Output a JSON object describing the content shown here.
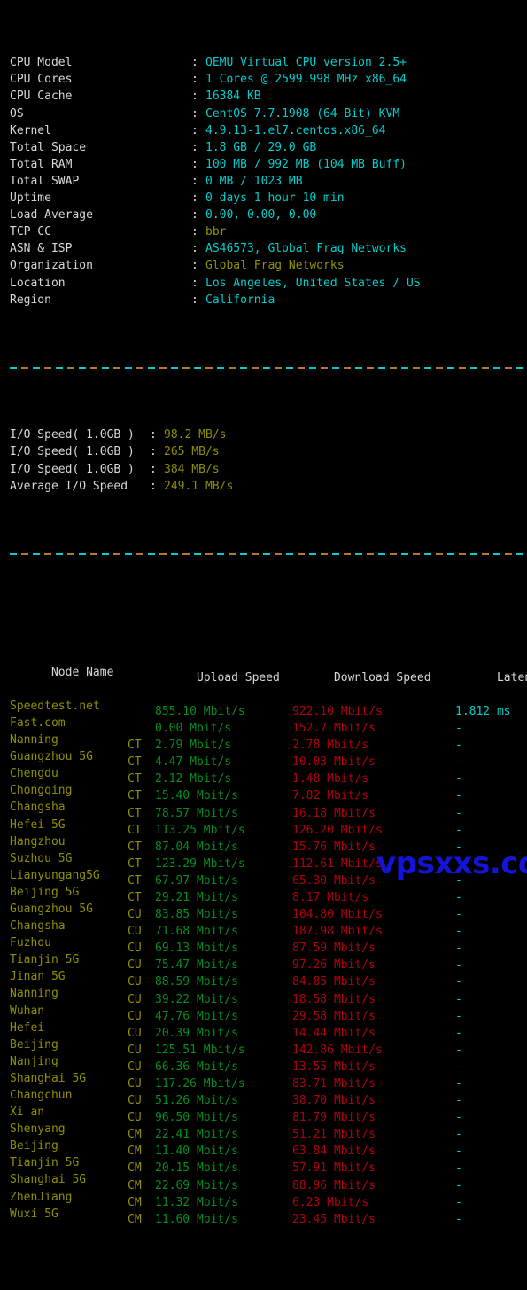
{
  "theme": {
    "background": "#000000",
    "label_color": "#d8d8d8",
    "cyan": "#00cdcd",
    "yellow": "#8f8f00",
    "green": "#008f1f",
    "red": "#b00010",
    "watermark_color": "#1414d8"
  },
  "sysinfo": {
    "colon": ":",
    "rows": [
      {
        "label": "CPU Model",
        "value": "QEMU Virtual CPU version 2.5+",
        "color": "c-cyan"
      },
      {
        "label": "CPU Cores",
        "value": "1 Cores @ 2599.998 MHz x86_64",
        "color": "c-cyan"
      },
      {
        "label": "CPU Cache",
        "value": "16384 KB",
        "color": "c-cyan"
      },
      {
        "label": "OS",
        "value": "CentOS 7.7.1908 (64 Bit) KVM",
        "color": "c-cyan"
      },
      {
        "label": "Kernel",
        "value": "4.9.13-1.el7.centos.x86_64",
        "color": "c-cyan"
      },
      {
        "label": "Total Space",
        "value": "1.8 GB / 29.0 GB",
        "color": "c-cyan"
      },
      {
        "label": "Total RAM",
        "value": "100 MB / 992 MB (104 MB Buff)",
        "color": "c-cyan"
      },
      {
        "label": "Total SWAP",
        "value": "0 MB / 1023 MB",
        "color": "c-cyan"
      },
      {
        "label": "Uptime",
        "value": "0 days 1 hour 10 min",
        "color": "c-cyan"
      },
      {
        "label": "Load Average",
        "value": "0.00, 0.00, 0.00",
        "color": "c-cyan"
      },
      {
        "label": "TCP CC",
        "value": "bbr",
        "color": "c-yellow"
      },
      {
        "label": "ASN & ISP",
        "value": "AS46573, Global Frag Networks",
        "color": "c-cyan"
      },
      {
        "label": "Organization",
        "value": "Global Frag Networks",
        "color": "c-yellow"
      },
      {
        "label": "Location",
        "value": "Los Angeles, United States / US",
        "color": "c-cyan"
      },
      {
        "label": "Region",
        "value": "California",
        "color": "c-cyan"
      }
    ]
  },
  "iotest": {
    "colon": ":",
    "rows": [
      {
        "label": "I/O Speed( 1.0GB )",
        "value": "98.2 MB/s"
      },
      {
        "label": "I/O Speed( 1.0GB )",
        "value": "265 MB/s"
      },
      {
        "label": "I/O Speed( 1.0GB )",
        "value": "384 MB/s"
      },
      {
        "label": "Average I/O Speed",
        "value": "249.1 MB/s"
      }
    ]
  },
  "speedtest": {
    "headers": {
      "node": "Node Name",
      "isp": "",
      "upload": "Upload Speed",
      "download": "Download Speed",
      "latency": "Latency"
    },
    "rows": [
      {
        "node": "Speedtest.net",
        "isp": "",
        "upload": "855.10 Mbit/s",
        "download": "922.10 Mbit/s",
        "latency": "1.812 ms"
      },
      {
        "node": "Fast.com",
        "isp": "",
        "upload": "0.00 Mbit/s",
        "download": "152.7 Mbit/s",
        "latency": "-"
      },
      {
        "node": "Nanning",
        "isp": "CT",
        "upload": "2.79 Mbit/s",
        "download": "2.78 Mbit/s",
        "latency": "-"
      },
      {
        "node": "Guangzhou 5G",
        "isp": "CT",
        "upload": "4.47 Mbit/s",
        "download": "10.03 Mbit/s",
        "latency": "-"
      },
      {
        "node": "Chengdu",
        "isp": "CT",
        "upload": "2.12 Mbit/s",
        "download": "1.48 Mbit/s",
        "latency": "-"
      },
      {
        "node": "Chongqing",
        "isp": "CT",
        "upload": "15.40 Mbit/s",
        "download": "7.82 Mbit/s",
        "latency": "-"
      },
      {
        "node": "Changsha",
        "isp": "CT",
        "upload": "78.57 Mbit/s",
        "download": "16.18 Mbit/s",
        "latency": "-"
      },
      {
        "node": "Hefei 5G",
        "isp": "CT",
        "upload": "113.25 Mbit/s",
        "download": "126.20 Mbit/s",
        "latency": "-"
      },
      {
        "node": "Hangzhou",
        "isp": "CT",
        "upload": "87.04 Mbit/s",
        "download": "15.76 Mbit/s",
        "latency": "-"
      },
      {
        "node": "Suzhou 5G",
        "isp": "CT",
        "upload": "123.29 Mbit/s",
        "download": "112.61 Mbit/s",
        "latency": "-"
      },
      {
        "node": "Lianyungang5G",
        "isp": "CT",
        "upload": "67.97 Mbit/s",
        "download": "65.30 Mbit/s",
        "latency": "-"
      },
      {
        "node": "Beijing 5G",
        "isp": "CT",
        "upload": "29.21 Mbit/s",
        "download": "8.17 Mbit/s",
        "latency": "-"
      },
      {
        "node": "Guangzhou 5G",
        "isp": "CU",
        "upload": "83.85 Mbit/s",
        "download": "104.80 Mbit/s",
        "latency": "-"
      },
      {
        "node": "Changsha",
        "isp": "CU",
        "upload": "71.68 Mbit/s",
        "download": "187.98 Mbit/s",
        "latency": "-"
      },
      {
        "node": "Fuzhou",
        "isp": "CU",
        "upload": "69.13 Mbit/s",
        "download": "87.59 Mbit/s",
        "latency": "-"
      },
      {
        "node": "Tianjin 5G",
        "isp": "CU",
        "upload": "75.47 Mbit/s",
        "download": "97.26 Mbit/s",
        "latency": "-"
      },
      {
        "node": "Jinan 5G",
        "isp": "CU",
        "upload": "88.59 Mbit/s",
        "download": "84.85 Mbit/s",
        "latency": "-"
      },
      {
        "node": "Nanning",
        "isp": "CU",
        "upload": "39.22 Mbit/s",
        "download": "18.58 Mbit/s",
        "latency": "-"
      },
      {
        "node": "Wuhan",
        "isp": "CU",
        "upload": "47.76 Mbit/s",
        "download": "29.58 Mbit/s",
        "latency": "-"
      },
      {
        "node": "Hefei",
        "isp": "CU",
        "upload": "20.39 Mbit/s",
        "download": "14.44 Mbit/s",
        "latency": "-"
      },
      {
        "node": "Beijing",
        "isp": "CU",
        "upload": "125.51 Mbit/s",
        "download": "142.86 Mbit/s",
        "latency": "-"
      },
      {
        "node": "Nanjing",
        "isp": "CU",
        "upload": "66.36 Mbit/s",
        "download": "13.55 Mbit/s",
        "latency": "-"
      },
      {
        "node": "ShangHai 5G",
        "isp": "CU",
        "upload": "117.26 Mbit/s",
        "download": "83.71 Mbit/s",
        "latency": "-"
      },
      {
        "node": "Changchun",
        "isp": "CU",
        "upload": "51.26 Mbit/s",
        "download": "38.70 Mbit/s",
        "latency": "-"
      },
      {
        "node": "Xi an",
        "isp": "CU",
        "upload": "96.50 Mbit/s",
        "download": "81.79 Mbit/s",
        "latency": "-"
      },
      {
        "node": "Shenyang",
        "isp": "CM",
        "upload": "22.41 Mbit/s",
        "download": "51.21 Mbit/s",
        "latency": "-"
      },
      {
        "node": "Beijing",
        "isp": "CM",
        "upload": "11.40 Mbit/s",
        "download": "63.84 Mbit/s",
        "latency": "-"
      },
      {
        "node": "Tianjin 5G",
        "isp": "CM",
        "upload": "20.15 Mbit/s",
        "download": "57.91 Mbit/s",
        "latency": "-"
      },
      {
        "node": "Shanghai 5G",
        "isp": "CM",
        "upload": "22.69 Mbit/s",
        "download": "88.96 Mbit/s",
        "latency": "-"
      },
      {
        "node": "ZhenJiang",
        "isp": "CM",
        "upload": "11.32 Mbit/s",
        "download": "6.23 Mbit/s",
        "latency": "-"
      },
      {
        "node": "Wuxi 5G",
        "isp": "CM",
        "upload": "11.60 Mbit/s",
        "download": "23.45 Mbit/s",
        "latency": "-"
      }
    ]
  },
  "watermark": {
    "text": "vpsxxs.com"
  }
}
